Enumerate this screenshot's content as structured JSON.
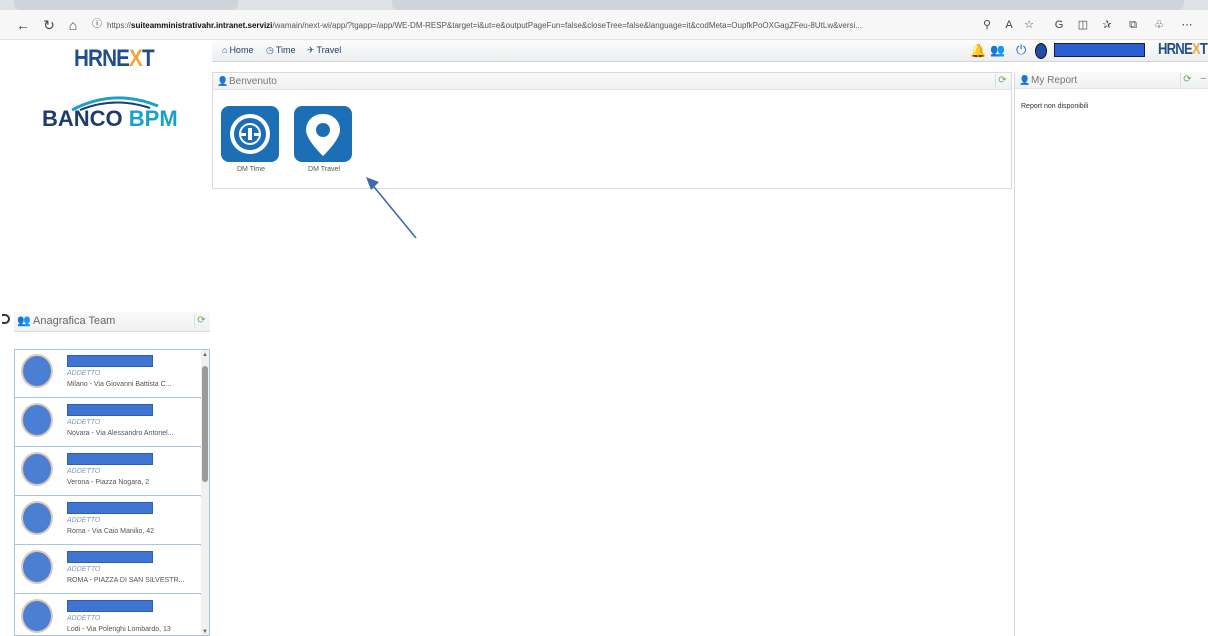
{
  "browser": {
    "url_prefix": "https://",
    "url_host": "suiteamministrativahr.intranet.servizi",
    "url_path": "/wamain/next-wi/app/?tgapp=/app/WE-DM-RESP&target=i&ut=e&outputPageFun=false&closeTree=false&language=it&codMeta=OupfkPoOXGagZFeu-8UtLw&versi..."
  },
  "brand": {
    "hrnext_prefix": "HR",
    "hrnext_mid": "NE",
    "hrnext_x": "X",
    "hrnext_suffix": "T",
    "bank_part1": "BANCO ",
    "bank_part2": "BPM"
  },
  "nav": {
    "home": "Home",
    "time": "Time",
    "travel": "Travel"
  },
  "welcome": {
    "title": "Benvenuto",
    "tiles": [
      {
        "label": "DM Time",
        "icon": "dm-time-icon"
      },
      {
        "label": "DM Travel",
        "icon": "dm-travel-icon"
      }
    ]
  },
  "report": {
    "title": "My Report",
    "empty_message": "Report non disponibili"
  },
  "team": {
    "title": "Anagrafica Team",
    "members": [
      {
        "role": "ADDETTO",
        "address": "Milano - Via Giovanni Battista C..."
      },
      {
        "role": "ADDETTO",
        "address": "Novara - Via Alessandro Antonel..."
      },
      {
        "role": "ADDETTO",
        "address": "Verona - Piazza Nogara, 2"
      },
      {
        "role": "ADDETTO",
        "address": "Roma - Via Caio Manilio, 42"
      },
      {
        "role": "ADDETTO",
        "address": "ROMA - PIAZZA DI SAN SILVESTR..."
      },
      {
        "role": "ADDETTO",
        "address": "Lodi - Via Polenghi Lombardo, 13"
      }
    ]
  },
  "colors": {
    "brand_blue": "#1f4e8c",
    "accent_orange": "#f2a63a",
    "tile_blue": "#1c6fb5",
    "redaction_blue": "#3f74d0"
  }
}
